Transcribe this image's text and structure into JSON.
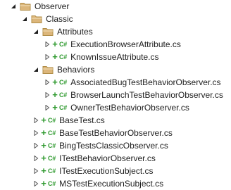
{
  "tree": {
    "root": {
      "label": "Observer",
      "expanded": true
    },
    "classic": {
      "label": "Classic",
      "expanded": true
    },
    "attributes": {
      "label": "Attributes",
      "expanded": true,
      "files": [
        {
          "label": "ExecutionBrowserAttribute.cs",
          "status": "+",
          "badge": "C#"
        },
        {
          "label": "KnownIssueAttribute.cs",
          "status": "+",
          "badge": "C#"
        }
      ]
    },
    "behaviors": {
      "label": "Behaviors",
      "expanded": true,
      "files": [
        {
          "label": "AssociatedBugTestBehaviorObserver.cs",
          "status": "+",
          "badge": "C#"
        },
        {
          "label": "BrowserLaunchTestBehaviorObserver.cs",
          "status": "+",
          "badge": "C#"
        },
        {
          "label": "OwnerTestBehaviorObserver.cs",
          "status": "+",
          "badge": "C#"
        }
      ]
    },
    "classic_files": [
      {
        "label": "BaseTest.cs",
        "status": "+",
        "badge": "C#"
      },
      {
        "label": "BaseTestBehaviorObserver.cs",
        "status": "+",
        "badge": "C#"
      },
      {
        "label": "BingTestsClassicObserver.cs",
        "status": "+",
        "badge": "C#"
      },
      {
        "label": "ITestBehaviorObserver.cs",
        "status": "+",
        "badge": "C#"
      },
      {
        "label": "ITestExecutionSubject.cs",
        "status": "+",
        "badge": "C#"
      },
      {
        "label": "MSTestExecutionSubject.cs",
        "status": "+",
        "badge": "C#"
      }
    ]
  },
  "colors": {
    "folder_fill": "#dcb67a",
    "folder_stroke": "#b08d47",
    "added_green": "#2f9a2f",
    "text": "#1e1e1e",
    "expander_expanded": "#1e1e1e",
    "expander_collapsed": "#555555"
  }
}
